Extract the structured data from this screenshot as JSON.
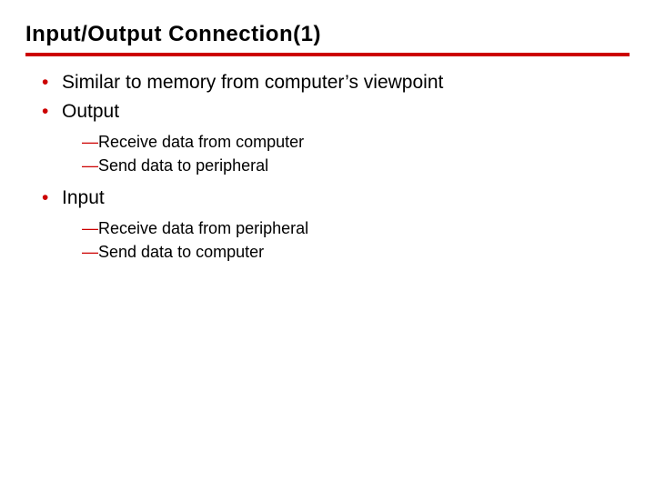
{
  "title": "Input/Output Connection(1)",
  "bullets": {
    "b0": "Similar to memory from computer’s viewpoint",
    "b1": "Output",
    "b1_sub0": "Receive data from computer",
    "b1_sub1": "Send data to peripheral",
    "b2": "Input",
    "b2_sub0": "Receive data from peripheral",
    "b2_sub1": "Send data to computer"
  },
  "dash": "—"
}
